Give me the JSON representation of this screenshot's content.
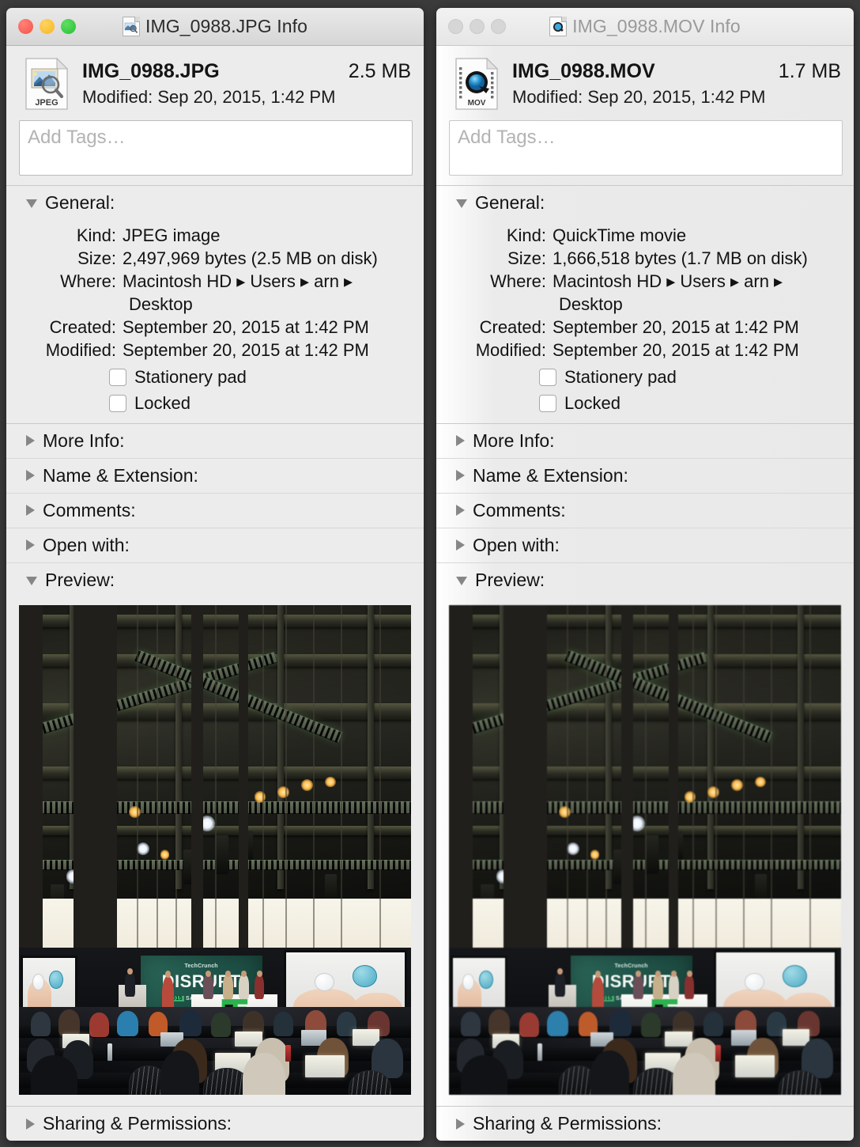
{
  "windows": [
    {
      "id": "jpg",
      "active": true,
      "titlebar": {
        "title": "IMG_0988.JPG Info",
        "icon": "jpeg-document-icon"
      },
      "lights": {
        "close": "close-button",
        "minimize": "minimize-button",
        "maximize": "maximize-button"
      },
      "header": {
        "icon_label": "JPEG",
        "filename": "IMG_0988.JPG",
        "size": "2.5 MB",
        "modified": "Modified: Sep 20, 2015, 1:42 PM"
      },
      "tags": {
        "placeholder": "Add Tags…",
        "value": ""
      },
      "general": {
        "label": "General:",
        "expanded": true,
        "rows": [
          {
            "key": "Kind:",
            "value": "JPEG image"
          },
          {
            "key": "Size:",
            "value": "2,497,969 bytes (2.5 MB on disk)"
          },
          {
            "key": "Where:",
            "value": "Macintosh HD ▸ Users ▸ arn ▸",
            "continuation": "Desktop"
          },
          {
            "key": "Created:",
            "value": "September 20, 2015 at 1:42 PM"
          },
          {
            "key": "Modified:",
            "value": "September 20, 2015 at 1:42 PM"
          }
        ],
        "checkboxes": [
          {
            "label": "Stationery pad",
            "checked": false
          },
          {
            "label": "Locked",
            "checked": false
          }
        ]
      },
      "sections": [
        {
          "label": "More Info:",
          "expanded": false
        },
        {
          "label": "Name & Extension:",
          "expanded": false
        },
        {
          "label": "Comments:",
          "expanded": false
        },
        {
          "label": "Open with:",
          "expanded": false
        }
      ],
      "preview": {
        "label": "Preview:",
        "expanded": true
      },
      "sharing": {
        "label": "Sharing & Permissions:",
        "expanded": false
      }
    },
    {
      "id": "mov",
      "active": false,
      "titlebar": {
        "title": "IMG_0988.MOV Info",
        "icon": "quicktime-document-icon"
      },
      "lights": {
        "close": "close-button",
        "minimize": "minimize-button",
        "maximize": "maximize-button"
      },
      "header": {
        "icon_label": "MOV",
        "filename": "IMG_0988.MOV",
        "size": "1.7 MB",
        "modified": "Modified: Sep 20, 2015, 1:42 PM"
      },
      "tags": {
        "placeholder": "Add Tags…",
        "value": ""
      },
      "general": {
        "label": "General:",
        "expanded": true,
        "rows": [
          {
            "key": "Kind:",
            "value": "QuickTime movie"
          },
          {
            "key": "Size:",
            "value": "1,666,518 bytes (1.7 MB on disk)"
          },
          {
            "key": "Where:",
            "value": "Macintosh HD ▸ Users ▸ arn ▸",
            "continuation": "Desktop"
          },
          {
            "key": "Created:",
            "value": "September 20, 2015 at 1:42 PM"
          },
          {
            "key": "Modified:",
            "value": "September 20, 2015 at 1:42 PM"
          }
        ],
        "checkboxes": [
          {
            "label": "Stationery pad",
            "checked": false
          },
          {
            "label": "Locked",
            "checked": false
          }
        ]
      },
      "sections": [
        {
          "label": "More Info:",
          "expanded": false
        },
        {
          "label": "Name & Extension:",
          "expanded": false
        },
        {
          "label": "Comments:",
          "expanded": false
        },
        {
          "label": "Open with:",
          "expanded": false
        }
      ],
      "preview": {
        "label": "Preview:",
        "expanded": true
      },
      "sharing": {
        "label": "Sharing & Permissions:",
        "expanded": false
      }
    }
  ],
  "preview_photo": {
    "scene": "TechCrunch Disrupt conference hall, audience with laptops facing stage",
    "banner_brand": "TechCrunch",
    "banner_title": "DISRUPT",
    "banner_sub_badge": "2015",
    "banner_sub_text": "SAN FRANCISCO",
    "stage_logo": "TC"
  },
  "colors": {
    "desktop": "#3c3c3c",
    "window_body": "#ececec",
    "titlebar_active_top": "#e9e9e9",
    "titlebar_active_bottom": "#d6d6d6",
    "light_close": "#f4524a",
    "light_min": "#f5b726",
    "light_max": "#27bf33",
    "light_inactive": "#d6d6d6",
    "text_primary": "#121212",
    "text_inactive_title": "#9a9a9a",
    "placeholder": "#b3b3b3",
    "separator": "#c9c9c9",
    "disclosure_triangle": "#868686",
    "banner_green": "#21564b",
    "tc_logo_green": "#2bb24c"
  }
}
